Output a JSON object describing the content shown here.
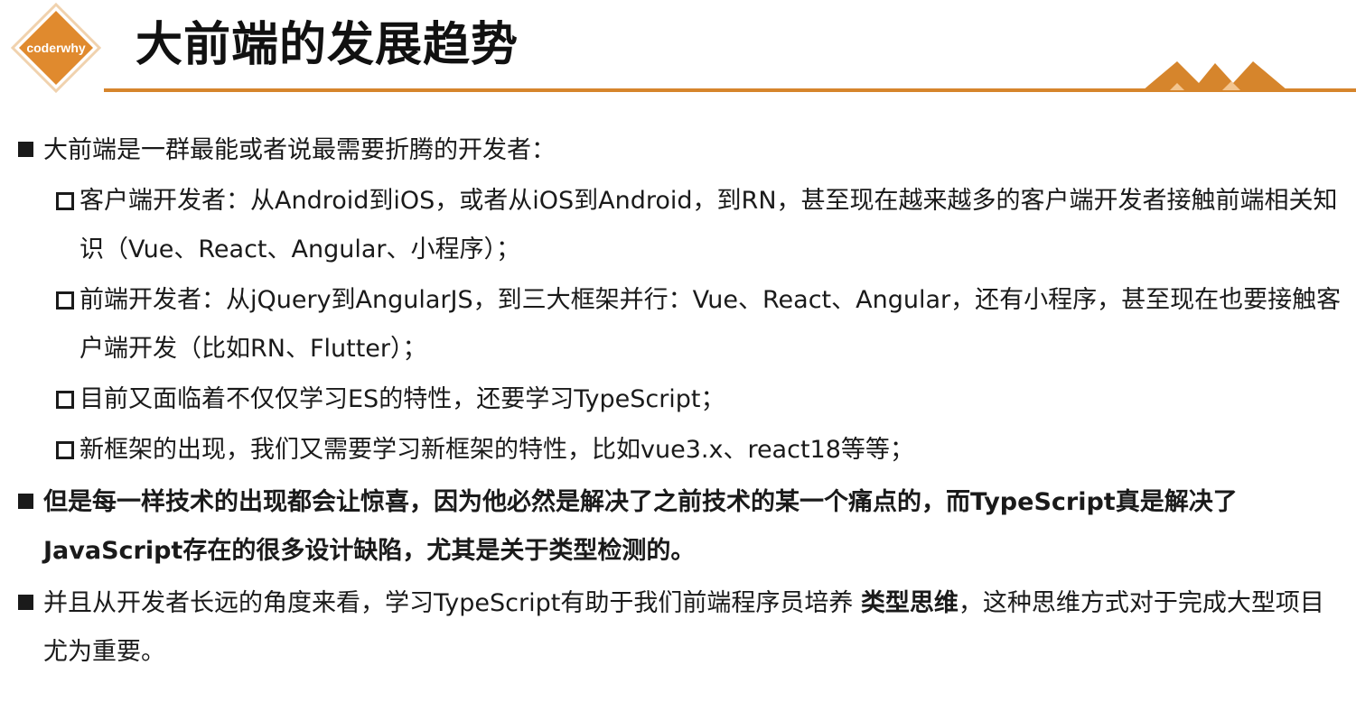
{
  "logo": {
    "text": "coderwhy",
    "color": "#e08a2e"
  },
  "title": "大前端的发展趋势",
  "accent_color": "#d6852c",
  "bullets": [
    {
      "text": "大前端是一群最能或者说最需要折腾的开发者："
    },
    {
      "text": "客户端开发者：从Android到iOS，或者从iOS到Android，到RN，甚至现在越来越多的客户端开发者接触前端相关知识（Vue、React、Angular、小程序）；"
    },
    {
      "text": "前端开发者：从jQuery到AngularJS，到三大框架并行：Vue、React、Angular，还有小程序，甚至现在也要接触客户端开发（比如RN、Flutter）；"
    },
    {
      "text": "目前又面临着不仅仅学习ES的特性，还要学习TypeScript；"
    },
    {
      "text": "新框架的出现，我们又需要学习新框架的特性，比如vue3.x、react18等等；"
    },
    {
      "text": "但是每一样技术的出现都会让惊喜，因为他必然是解决了之前技术的某一个痛点的，而TypeScript真是解决了JavaScript存在的很多设计缺陷，尤其是关于类型检测的。"
    },
    {
      "text_before": "并且从开发者长远的角度来看，学习TypeScript有助于我们前端程序员培养 ",
      "emphasis": "类型思维",
      "text_after": "，这种思维方式对于完成大型项目尤为重要。"
    }
  ]
}
